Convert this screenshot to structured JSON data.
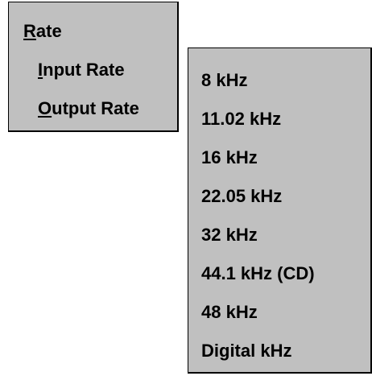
{
  "menu": {
    "header": {
      "mnemonic": "R",
      "rest": "ate"
    },
    "items": [
      {
        "mnemonic": "I",
        "rest": "nput Rate"
      },
      {
        "mnemonic": "O",
        "rest": "utput Rate"
      }
    ]
  },
  "submenu": {
    "items": [
      "8 kHz",
      "11.02 kHz",
      "16 kHz",
      "22.05 kHz",
      "32 kHz",
      "44.1 kHz (CD)",
      "48 kHz",
      "Digital kHz"
    ]
  },
  "colors": {
    "menu_bg": "#c0c0c0",
    "border": "#000000",
    "text": "#000000"
  }
}
